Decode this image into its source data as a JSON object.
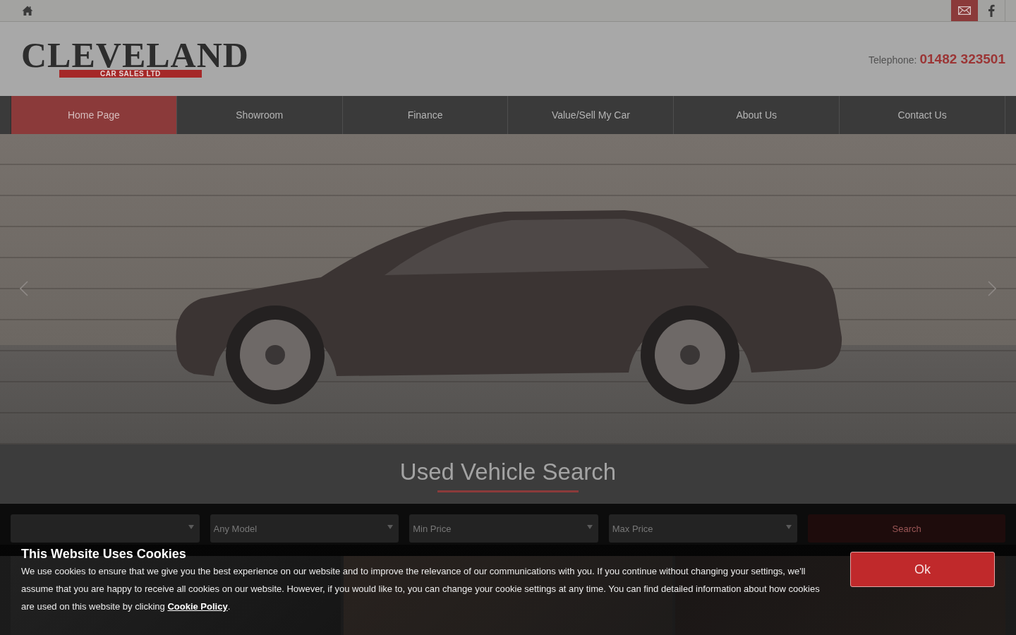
{
  "header": {
    "logo": {
      "name": "CLEVELAND",
      "tagline": "CAR SALES LTD"
    },
    "telephone": {
      "label": "Telephone:",
      "number": "01482 323501"
    }
  },
  "nav": [
    {
      "label": "Home Page",
      "selected": true
    },
    {
      "label": "Showroom",
      "selected": false
    },
    {
      "label": "Finance",
      "selected": false
    },
    {
      "label": "Value/Sell My Car",
      "selected": false
    },
    {
      "label": "About Us",
      "selected": false
    },
    {
      "label": "Contact Us",
      "selected": false
    }
  ],
  "vehicle_search": {
    "title": "Used Vehicle Search",
    "fields": [
      {
        "kind": "select"
      },
      {
        "kind": "select",
        "placeholder": "Any Model"
      },
      {
        "kind": "select",
        "placeholder": "Min Price"
      },
      {
        "kind": "select",
        "placeholder": "Max Price"
      }
    ],
    "button": "Search"
  },
  "cookie_banner": {
    "title": "This Website Uses Cookies",
    "message": "We use cookies to ensure that we give you the best experience on our website and to improve the relevance of our communications with you. If you continue without changing your settings, we'll assume that you are happy to receive all cookies on our website. However, if you would like to, you can change your cookie settings at any time. You can find detailed information about how cookies are used on this website by clicking",
    "link": "Cookie Policy",
    "message_end": ".",
    "button": "Ok"
  }
}
